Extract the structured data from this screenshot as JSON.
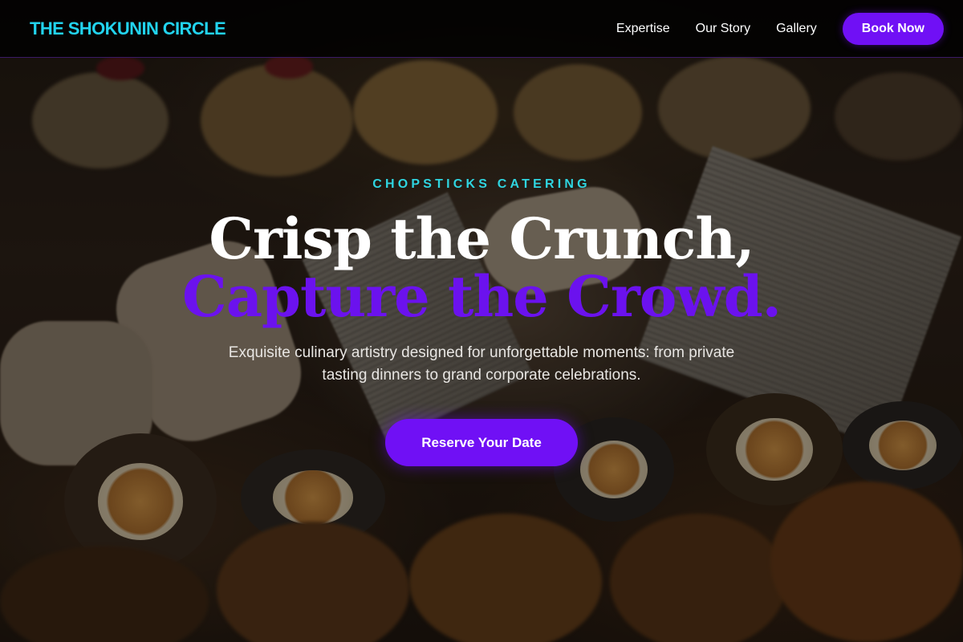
{
  "navbar": {
    "brand": "THE SHOKUNIN CIRCLE",
    "links": [
      "Expertise",
      "Our Story",
      "Gallery"
    ],
    "cta_label": "Book Now"
  },
  "hero": {
    "eyebrow": "CHOPSTICKS CATERING",
    "headline_line1": "Crisp the Crunch,",
    "headline_line2": "Capture the Crowd.",
    "subtitle": "Exquisite culinary artistry designed for unforgettable moments: from private tasting dinners to grand corporate celebrations.",
    "cta_label": "Reserve Your Date"
  },
  "colors": {
    "brand_cyan": "#22d3ee",
    "accent_purple": "#7010f5",
    "headline_white": "#ffffff"
  }
}
